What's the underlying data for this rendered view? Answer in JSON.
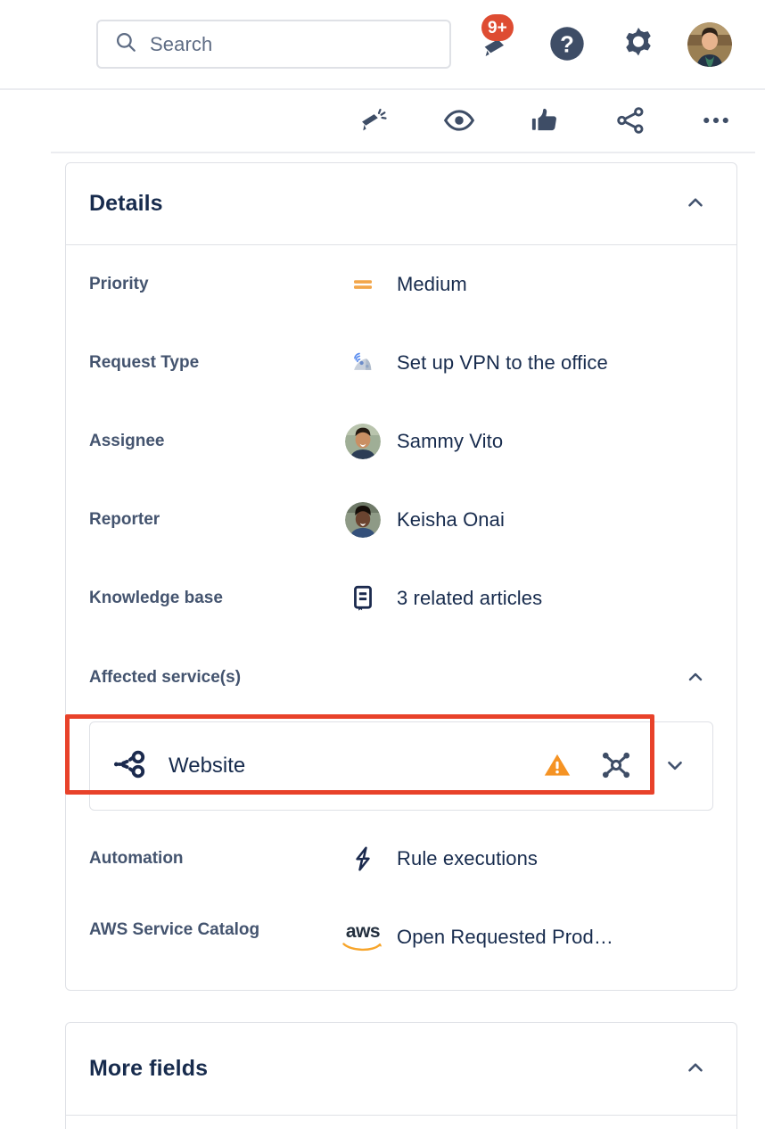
{
  "appbar": {
    "search": {
      "placeholder": "Search",
      "value": "",
      "icon": "search-icon"
    },
    "notifications": {
      "icon": "notification-bell-icon",
      "badge": "9+",
      "badge_color": "#DE4C32"
    },
    "help": {
      "icon": "help-circle-icon"
    },
    "settings": {
      "icon": "gear-icon"
    },
    "profile": {
      "icon": "avatar",
      "label": "Your profile and settings"
    }
  },
  "toolbar": {
    "items": [
      {
        "icon": "megaphone-icon",
        "label": "Give feedback"
      },
      {
        "icon": "eye-icon",
        "label": "Watch"
      },
      {
        "icon": "thumbs-up-icon",
        "label": "Like"
      },
      {
        "icon": "share-icon",
        "label": "Share"
      },
      {
        "icon": "more-options-icon",
        "label": "More actions"
      }
    ]
  },
  "details_panel": {
    "title": "Details",
    "collapse_icon": "chevron-up-icon",
    "fields": [
      {
        "label": "Priority",
        "value": "Medium",
        "icon": "priority-medium-icon"
      },
      {
        "label": "Request Type",
        "value": "Set up VPN to the office",
        "icon": "satellite-dish-icon"
      },
      {
        "label": "Assignee",
        "value": "Sammy Vito",
        "icon": "user-avatar"
      },
      {
        "label": "Reporter",
        "value": "Keisha Onai",
        "icon": "user-avatar"
      },
      {
        "label": "Knowledge base",
        "value": "3 related articles",
        "icon": "knowledge-base-icon",
        "highlighted": true
      }
    ],
    "affected_services": {
      "title": "Affected service(s)",
      "collapse_icon": "chevron-up-icon",
      "services": [
        {
          "name": "Website",
          "icon": "service-branch-icon",
          "status_icon": "warning-triangle-icon",
          "graph_icon": "dependency-graph-icon",
          "expand_icon": "chevron-down-icon"
        }
      ]
    },
    "extra_fields": [
      {
        "label": "Automation",
        "value": "Rule executions",
        "icon": "lightning-bolt-icon"
      },
      {
        "label": "AWS Service Catalog",
        "value": "Open Requested Prod…",
        "icon": "aws-logo",
        "icon_text": "aws"
      }
    ]
  },
  "more_fields_panel": {
    "title": "More fields",
    "collapse_icon": "chevron-up-icon"
  },
  "colors": {
    "text_primary": "#172B4D",
    "text_subtle": "#44546F",
    "border": "#DFE1E6",
    "highlight": "#E8422A",
    "priority_medium": "#F2A64A",
    "warning": "#F59324",
    "badge": "#DE4C32"
  }
}
